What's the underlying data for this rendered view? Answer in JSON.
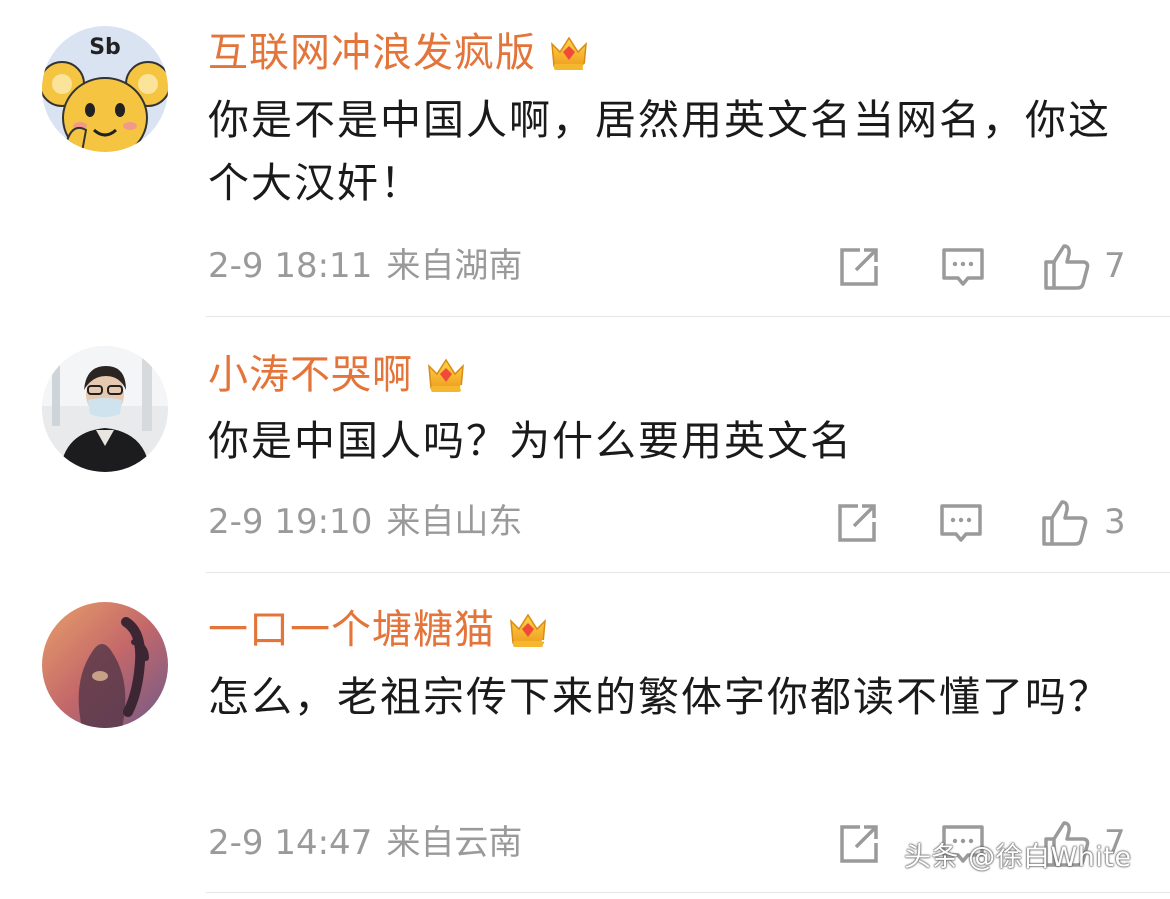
{
  "comments": [
    {
      "username": "互联网冲浪发疯版",
      "crown_level": "6",
      "avatar_text": "Sb",
      "text": "你是不是中国人啊，居然用英文名当网名，你这个大汉奸！",
      "date": "2-9 18:11",
      "location": "来自湖南",
      "likes": "7"
    },
    {
      "username": "小涛不哭啊",
      "crown_level": "5",
      "text": "你是中国人吗？为什么要用英文名",
      "date": "2-9 19:10",
      "location": "来自山东",
      "likes": "3"
    },
    {
      "username": "一口一个塘糖猫",
      "crown_level": "7",
      "text": "怎么，老祖宗传下来的繁体字你都读不懂了吗？",
      "date": "2-9 14:47",
      "location": "来自云南",
      "likes": "7"
    }
  ],
  "watermark": "头条 @徐白White",
  "colors": {
    "username": "#e3743a",
    "meta": "#9a9a9a",
    "body_text": "#1a1a1a",
    "divider": "#e6e6e6"
  }
}
